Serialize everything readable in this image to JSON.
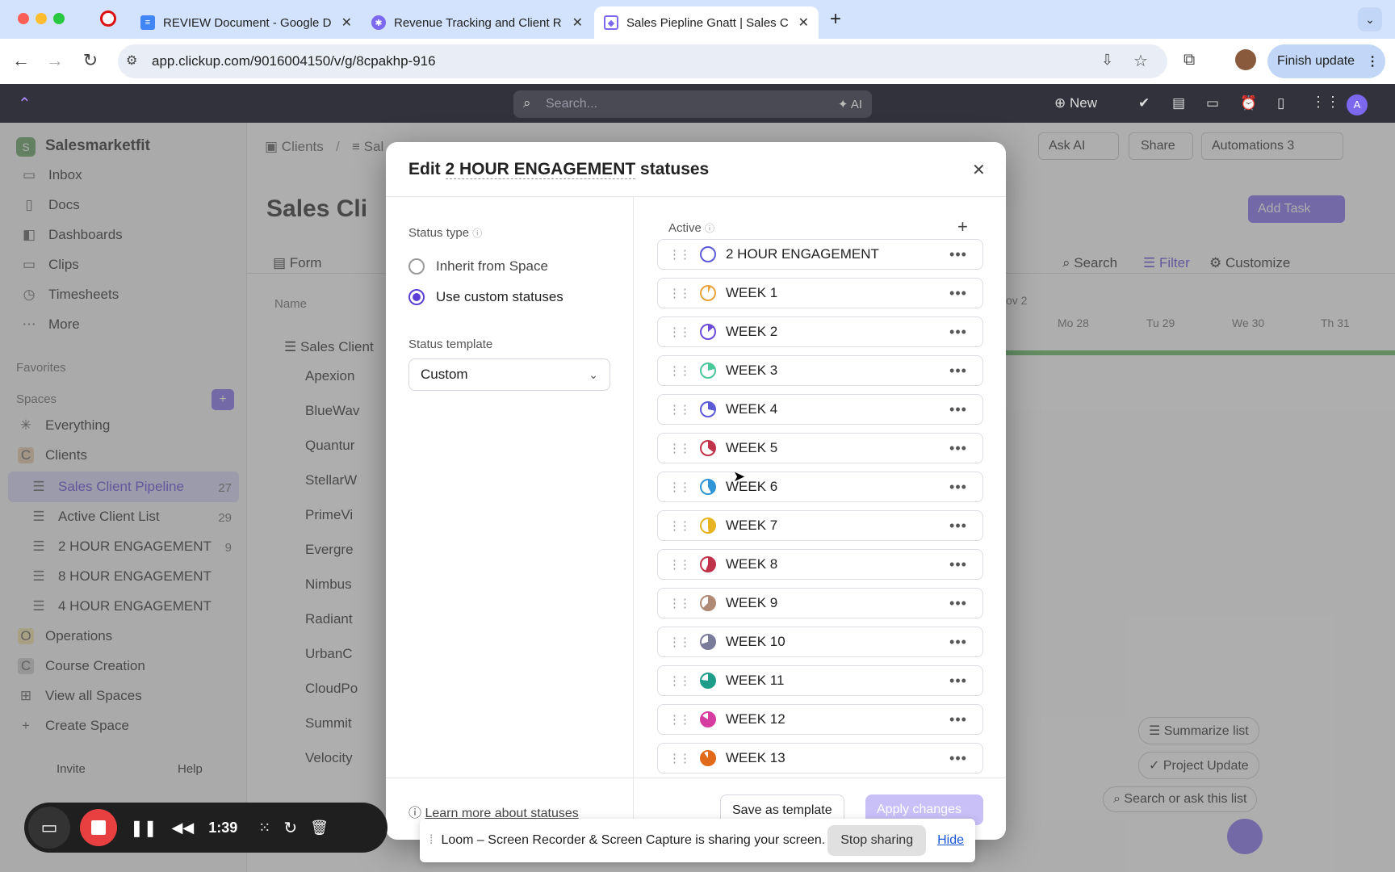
{
  "browser": {
    "tabs": [
      {
        "title": "REVIEW Document - Google D",
        "favicon": "docs-icon"
      },
      {
        "title": "Revenue Tracking and Client R",
        "favicon": "clickup-icon"
      },
      {
        "title": "Sales Piepline Gnatt | Sales C",
        "favicon": "clickup-icon"
      }
    ],
    "url": "app.clickup.com/9016004150/v/g/8cpakhp-916",
    "finish_update": "Finish update"
  },
  "app_header": {
    "search_placeholder": "Search...",
    "ai_label": "AI",
    "new_label": "New"
  },
  "sidebar": {
    "workspace": "Salesmarketfit",
    "workspace_initial": "S",
    "nav": [
      "Inbox",
      "Docs",
      "Dashboards",
      "Clips",
      "Timesheets",
      "More"
    ],
    "favorites": "Favorites",
    "spaces": "Spaces",
    "everything": "Everything",
    "space_clients": {
      "initial": "C",
      "name": "Clients"
    },
    "lists": [
      {
        "name": "Sales Client Pipeline",
        "count": "27"
      },
      {
        "name": "Active Client List",
        "count": "29"
      },
      {
        "name": "2 HOUR ENGAGEMENT",
        "count": "9"
      },
      {
        "name": "8 HOUR ENGAGEMENT",
        "count": ""
      },
      {
        "name": "4 HOUR ENGAGEMENT",
        "count": ""
      }
    ],
    "other_spaces": [
      {
        "initial": "O",
        "name": "Operations"
      },
      {
        "initial": "C",
        "name": "Course Creation"
      }
    ],
    "view_all": "View all Spaces",
    "create_space": "Create Space",
    "invite": "Invite",
    "help": "Help"
  },
  "main": {
    "breadcrumb_space": "Clients",
    "breadcrumb_list": "Sal",
    "page_title": "Sales Cli",
    "ask_ai": "Ask AI",
    "share": "Share",
    "automations": "Automations",
    "automations_count": "3",
    "add_task": "Add Task",
    "view_form": "Form",
    "search": "Search",
    "filter": "Filter",
    "customize": "Customize",
    "col_name": "Name",
    "timeline_month": "ov 2",
    "timeline_days": [
      "Mo 28",
      "Tu 29",
      "We 30",
      "Th 31"
    ],
    "rows": [
      "Sales Client",
      "Apexion",
      "BlueWav",
      "Quantur",
      "StellarW",
      "PrimeVi",
      "Evergre",
      "Nimbus",
      "Radiant",
      "UrbanC",
      "CloudPo",
      "Summit",
      "Velocity"
    ],
    "summarize": "Summarize list",
    "project_update": "Project Update",
    "search_ask": "Search or ask this list"
  },
  "modal": {
    "title_prefix": "Edit ",
    "title_name": "2 HOUR ENGAGEMENT",
    "title_suffix": " statuses",
    "status_type_label": "Status type",
    "option_inherit": "Inherit from Space",
    "option_custom": "Use custom statuses",
    "template_label": "Status template",
    "template_value": "Custom",
    "active_label": "Active",
    "statuses": [
      {
        "name": "2 HOUR ENGAGEMENT",
        "color": "#5b5bd6"
      },
      {
        "name": "WEEK 1",
        "color": "#e8a33b"
      },
      {
        "name": "WEEK 2",
        "color": "#6c4bd6"
      },
      {
        "name": "WEEK 3",
        "color": "#4bc79a"
      },
      {
        "name": "WEEK 4",
        "color": "#5b5bd6"
      },
      {
        "name": "WEEK 5",
        "color": "#c0334b"
      },
      {
        "name": "WEEK 6",
        "color": "#2f95d6"
      },
      {
        "name": "WEEK 7",
        "color": "#e8b320"
      },
      {
        "name": "WEEK 8",
        "color": "#c0334b"
      },
      {
        "name": "WEEK 9",
        "color": "#b08a75"
      },
      {
        "name": "WEEK 10",
        "color": "#7a7a9a"
      },
      {
        "name": "WEEK 11",
        "color": "#1e9e8a"
      },
      {
        "name": "WEEK 12",
        "color": "#d63da0"
      },
      {
        "name": "WEEK 13",
        "color": "#e06a1a"
      }
    ],
    "learn_more": "Learn more about statuses",
    "save_template": "Save as template",
    "apply": "Apply changes"
  },
  "loom": {
    "message": "Loom – Screen Recorder & Screen Capture is sharing your screen.",
    "stop": "Stop sharing",
    "hide": "Hide"
  },
  "recorder": {
    "time": "1:39"
  }
}
